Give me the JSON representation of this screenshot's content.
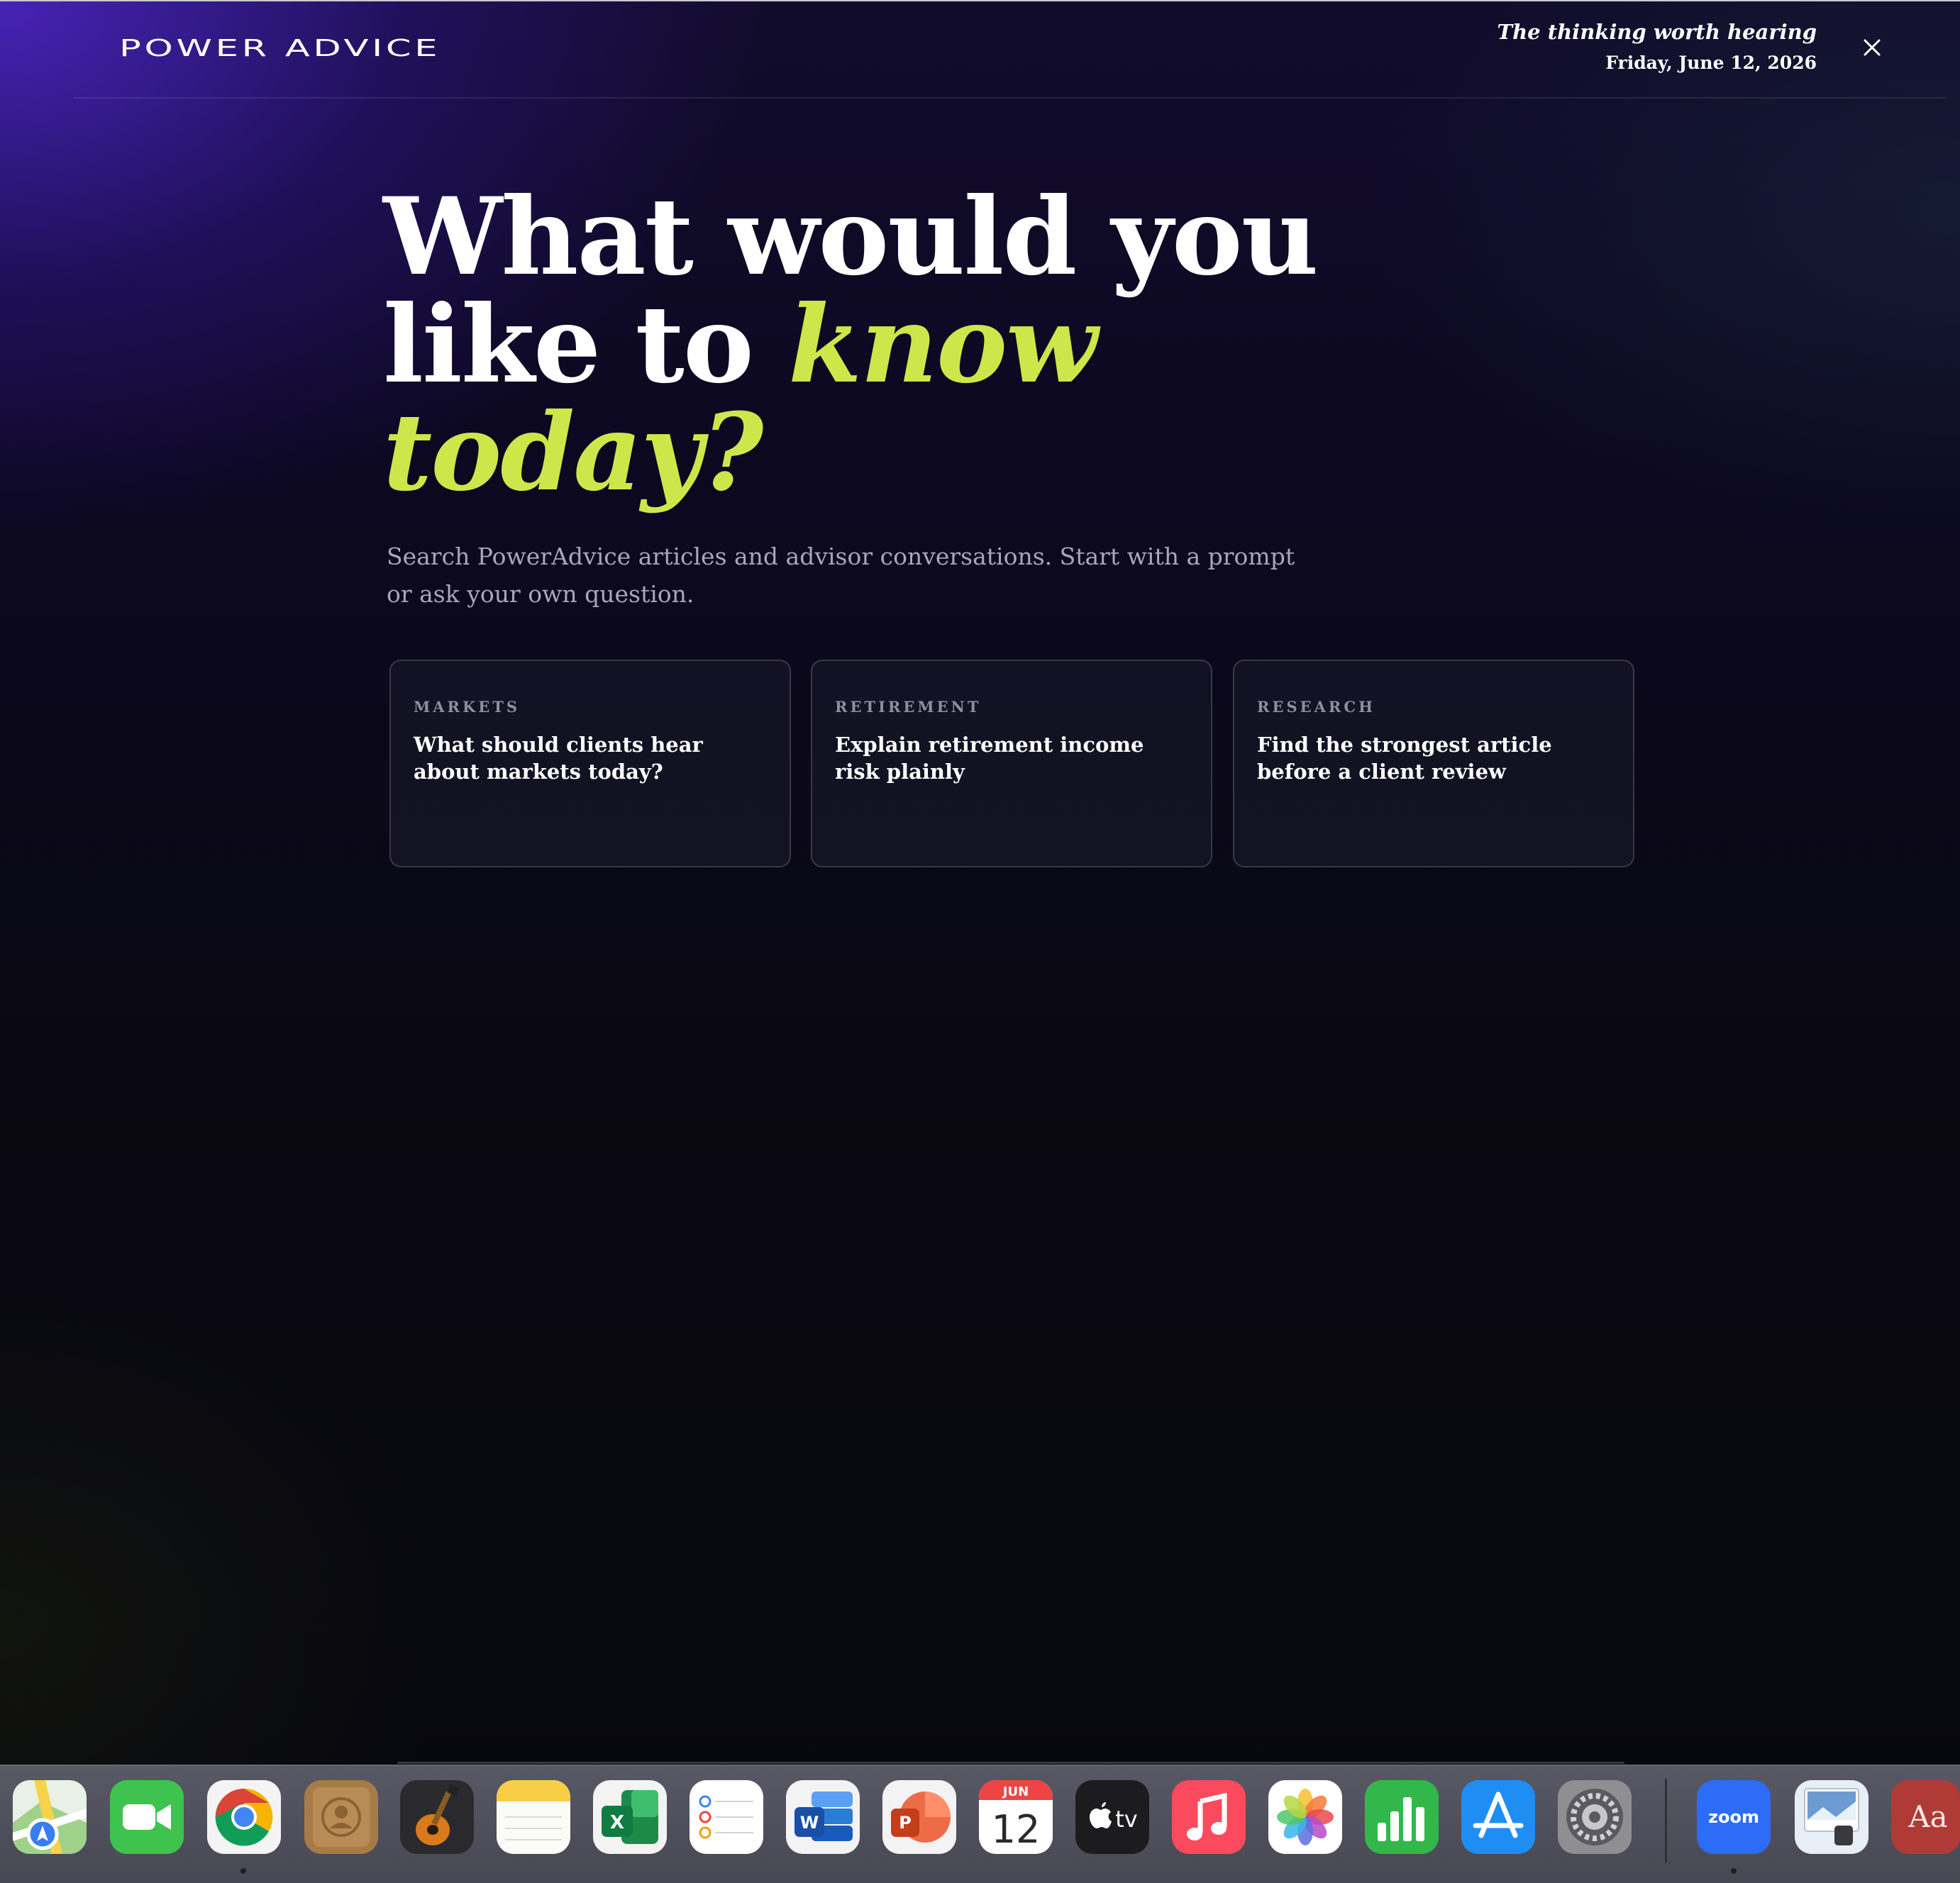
{
  "header": {
    "logo": "POWER ADVICE",
    "tagline": "The thinking worth hearing",
    "date": "Friday, June 12, 2026"
  },
  "hero": {
    "line1": "What would you",
    "line2_plain": "like to ",
    "line2_accent": "know",
    "line3_accent": "today?",
    "subtitle": "Search PowerAdvice articles and advisor conversations. Start with a prompt or ask your own question."
  },
  "prompts": [
    {
      "category": "MARKETS",
      "question": "What should clients hear about markets today?"
    },
    {
      "category": "RETIREMENT",
      "question": "Explain retirement income risk plainly"
    },
    {
      "category": "RESEARCH",
      "question": "Find the strongest article before a client review"
    }
  ],
  "dock": {
    "calendar_month": "JUN",
    "calendar_day": "12",
    "tv_label": "tv",
    "zoom_label": "zoom",
    "dictionary_label": "Aa",
    "excel_letter": "X",
    "word_letter": "W",
    "powerpoint_letter": "P"
  },
  "colors": {
    "accent": "#cde64a",
    "background_top": "#4a24be",
    "background_base": "#07070e"
  }
}
